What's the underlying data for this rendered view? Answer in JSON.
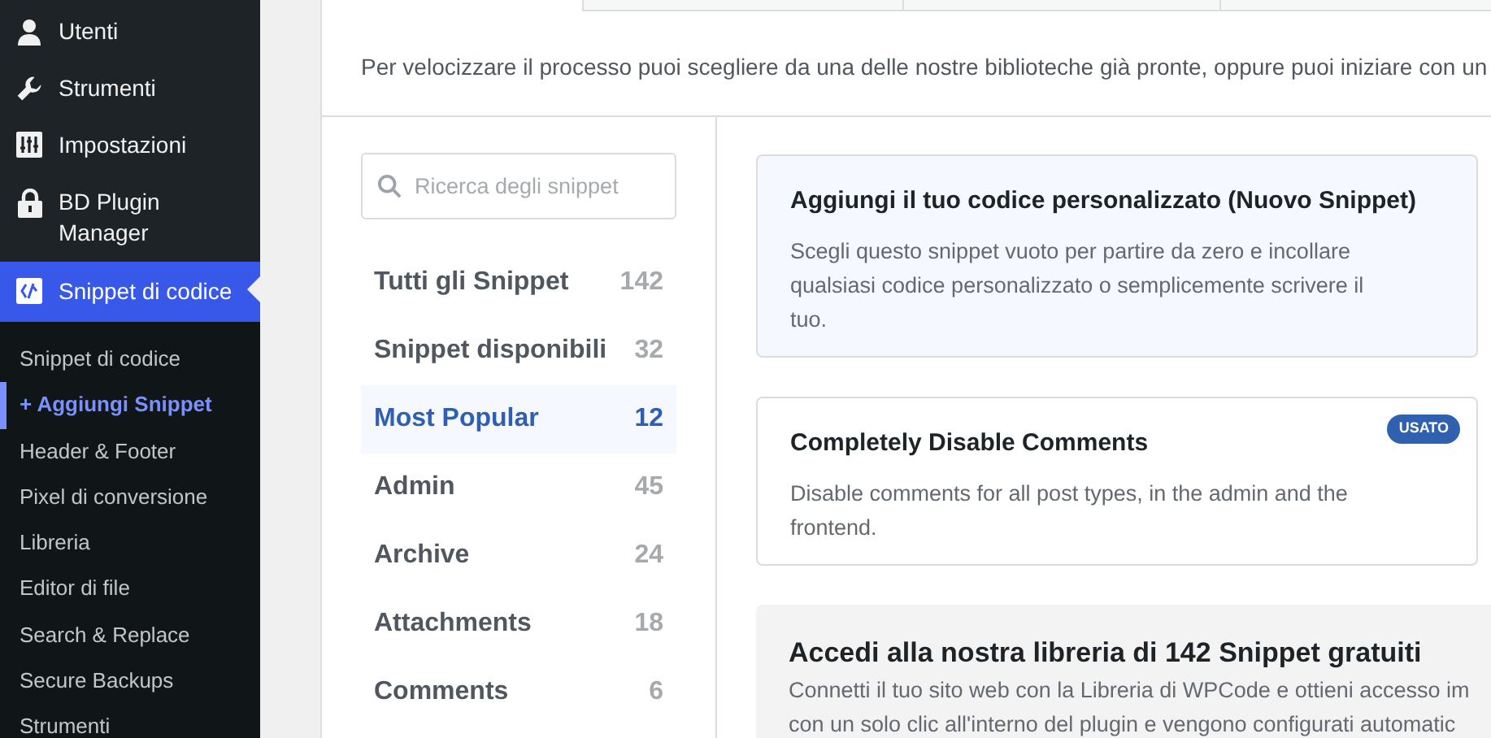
{
  "admin_menu": {
    "items": [
      {
        "label": "Utenti",
        "selected": false
      },
      {
        "label": "Strumenti",
        "selected": false
      },
      {
        "label": "Impostazioni",
        "selected": false
      },
      {
        "label": "BD Plugin Manager",
        "selected": false
      },
      {
        "label": "Snippet di codice",
        "selected": true
      }
    ],
    "submenu": [
      {
        "label": "Snippet di codice",
        "selected": false
      },
      {
        "label": "+ Aggiungi Snippet",
        "selected": true
      },
      {
        "label": "Header & Footer",
        "selected": false
      },
      {
        "label": "Pixel di conversione",
        "selected": false
      },
      {
        "label": "Libreria",
        "selected": false
      },
      {
        "label": "Editor di file",
        "selected": false
      },
      {
        "label": "Search & Replace",
        "selected": false
      },
      {
        "label": "Secure Backups",
        "selected": false
      },
      {
        "label": "Strumenti",
        "selected": false
      }
    ]
  },
  "intro": "Per velocizzare il processo puoi scegliere da una delle nostre biblioteche già pronte, oppure puoi iniziare con un",
  "search": {
    "placeholder": "Ricerca degli snippet"
  },
  "categories": [
    {
      "label": "Tutti gli Snippet",
      "count": "142",
      "selected": false
    },
    {
      "label": "Snippet disponibili",
      "count": "32",
      "selected": false
    },
    {
      "label": "Most Popular",
      "count": "12",
      "selected": true
    },
    {
      "label": "Admin",
      "count": "45",
      "selected": false
    },
    {
      "label": "Archive",
      "count": "24",
      "selected": false
    },
    {
      "label": "Attachments",
      "count": "18",
      "selected": false
    },
    {
      "label": "Comments",
      "count": "6",
      "selected": false
    }
  ],
  "cards": [
    {
      "kind": "custom",
      "title": "Aggiungi il tuo codice personalizzato (Nuovo Snippet)",
      "description": "Scegli questo snippet vuoto per partire da zero e incollare qualsiasi codice personalizzato o semplicemente scrivere il tuo."
    },
    {
      "kind": "snippet",
      "title": "Completely Disable Comments",
      "description": "Disable comments for all post types, in the admin and the frontend.",
      "badge": "USATO"
    },
    {
      "kind": "promo",
      "title": "Accedi alla nostra libreria di 142 Snippet gratuiti",
      "lines": [
        "Connetti il tuo sito web con la Libreria di WPCode e ottieni accesso im",
        "con un solo clic all'interno del plugin e vengono configurati automatic"
      ]
    }
  ]
}
